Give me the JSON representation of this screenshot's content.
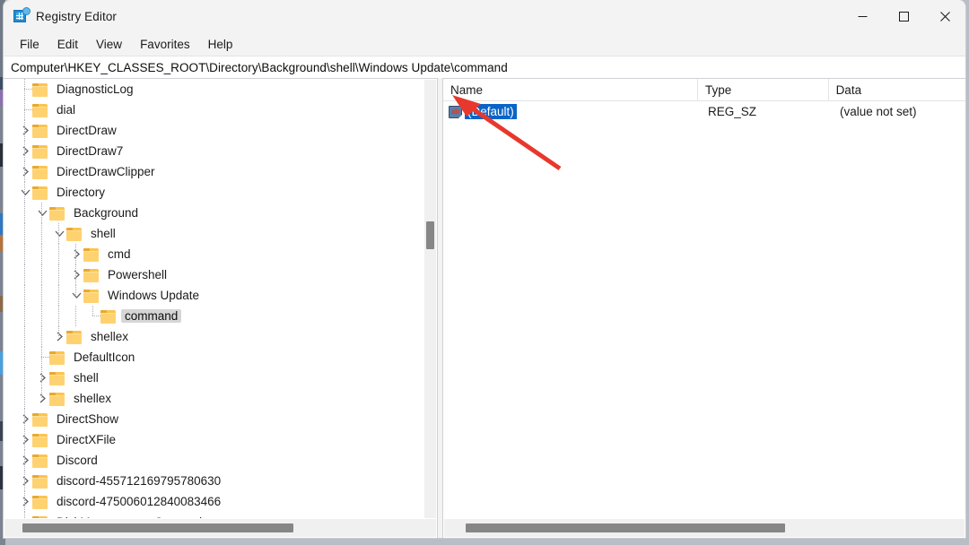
{
  "window": {
    "title": "Registry Editor",
    "icon": "registry-editor-icon",
    "controls": {
      "minimize": "minimize-icon",
      "maximize": "maximize-icon",
      "close": "close-icon"
    }
  },
  "menubar": {
    "items": [
      "File",
      "Edit",
      "View",
      "Favorites",
      "Help"
    ]
  },
  "address": {
    "path": "Computer\\HKEY_CLASSES_ROOT\\Directory\\Background\\shell\\Windows Update\\command"
  },
  "tree": {
    "nodes": [
      {
        "label": "DiagnosticLog",
        "depth": 1,
        "expander": "none",
        "selected": false
      },
      {
        "label": "dial",
        "depth": 1,
        "expander": "none",
        "selected": false
      },
      {
        "label": "DirectDraw",
        "depth": 1,
        "expander": "collapsed",
        "selected": false
      },
      {
        "label": "DirectDraw7",
        "depth": 1,
        "expander": "collapsed",
        "selected": false
      },
      {
        "label": "DirectDrawClipper",
        "depth": 1,
        "expander": "collapsed",
        "selected": false
      },
      {
        "label": "Directory",
        "depth": 1,
        "expander": "expanded",
        "selected": false
      },
      {
        "label": "Background",
        "depth": 2,
        "expander": "expanded",
        "selected": false
      },
      {
        "label": "shell",
        "depth": 3,
        "expander": "expanded",
        "selected": false
      },
      {
        "label": "cmd",
        "depth": 4,
        "expander": "collapsed",
        "selected": false
      },
      {
        "label": "Powershell",
        "depth": 4,
        "expander": "collapsed",
        "selected": false
      },
      {
        "label": "Windows Update",
        "depth": 4,
        "expander": "expanded",
        "selected": false
      },
      {
        "label": "command",
        "depth": 5,
        "expander": "none",
        "selected": true
      },
      {
        "label": "shellex",
        "depth": 3,
        "expander": "collapsed",
        "selected": false
      },
      {
        "label": "DefaultIcon",
        "depth": 2,
        "expander": "none",
        "selected": false
      },
      {
        "label": "shell",
        "depth": 2,
        "expander": "collapsed",
        "selected": false
      },
      {
        "label": "shellex",
        "depth": 2,
        "expander": "collapsed",
        "selected": false
      },
      {
        "label": "DirectShow",
        "depth": 1,
        "expander": "collapsed",
        "selected": false
      },
      {
        "label": "DirectXFile",
        "depth": 1,
        "expander": "collapsed",
        "selected": false
      },
      {
        "label": "Discord",
        "depth": 1,
        "expander": "collapsed",
        "selected": false
      },
      {
        "label": "discord-455712169795780630",
        "depth": 1,
        "expander": "collapsed",
        "selected": false
      },
      {
        "label": "discord-475006012840083466",
        "depth": 1,
        "expander": "collapsed",
        "selected": false
      },
      {
        "label": "DiskManagement.Connection",
        "depth": 1,
        "expander": "none",
        "selected": false
      }
    ]
  },
  "list": {
    "columns": [
      "Name",
      "Type",
      "Data"
    ],
    "rows": [
      {
        "icon": "string-value-icon",
        "icon_text": "ab",
        "name": "(Default)",
        "type": "REG_SZ",
        "data": "(value not set)",
        "selected": true
      }
    ]
  },
  "annotation": {
    "arrow": "red-arrow-pointer",
    "color": "#e8382e"
  },
  "colors": {
    "selection_active": "#0a64c8",
    "selection_inactive": "#d6d6d6",
    "folder": "#ffd271",
    "accent": "#1f8ad2"
  }
}
